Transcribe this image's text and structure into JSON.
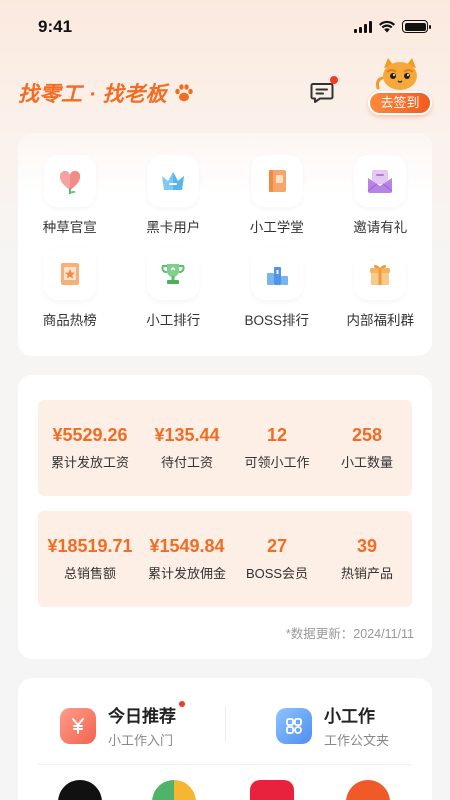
{
  "status_bar": {
    "time": "9:41"
  },
  "header": {
    "brand": "找零工 · 找老板",
    "checkin_label": "去签到"
  },
  "grid": [
    {
      "label": "种草官宣",
      "icon": "heart-flower-icon"
    },
    {
      "label": "黑卡用户",
      "icon": "crown-icon"
    },
    {
      "label": "小工学堂",
      "icon": "book-icon"
    },
    {
      "label": "邀请有礼",
      "icon": "envelope-icon"
    },
    {
      "label": "商品热榜",
      "icon": "star-card-icon"
    },
    {
      "label": "小工排行",
      "icon": "trophy-icon"
    },
    {
      "label": "BOSS排行",
      "icon": "podium-icon"
    },
    {
      "label": "内部福利群",
      "icon": "gift-icon"
    }
  ],
  "stats": {
    "row1": [
      {
        "value": "¥5529.26",
        "label": "累计发放工资"
      },
      {
        "value": "¥135.44",
        "label": "待付工资"
      },
      {
        "value": "12",
        "label": "可领小工作"
      },
      {
        "value": "258",
        "label": "小工数量"
      }
    ],
    "row2": [
      {
        "value": "¥18519.71",
        "label": "总销售额"
      },
      {
        "value": "¥1549.84",
        "label": "累计发放佣金"
      },
      {
        "value": "27",
        "label": "BOSS会员"
      },
      {
        "value": "39",
        "label": "热销产品"
      }
    ],
    "update_text": "*数据更新：2024/11/11"
  },
  "recommend": {
    "left": {
      "title": "今日推荐",
      "subtitle": "小工作入门",
      "icon": "yen-tag-icon"
    },
    "right": {
      "title": "小工作",
      "subtitle": "工作公文夹",
      "icon": "apps-icon"
    }
  },
  "colors": {
    "accent": "#f36c22",
    "stat_bg": "#fdeee6",
    "badge_red": "#f13b2a"
  }
}
